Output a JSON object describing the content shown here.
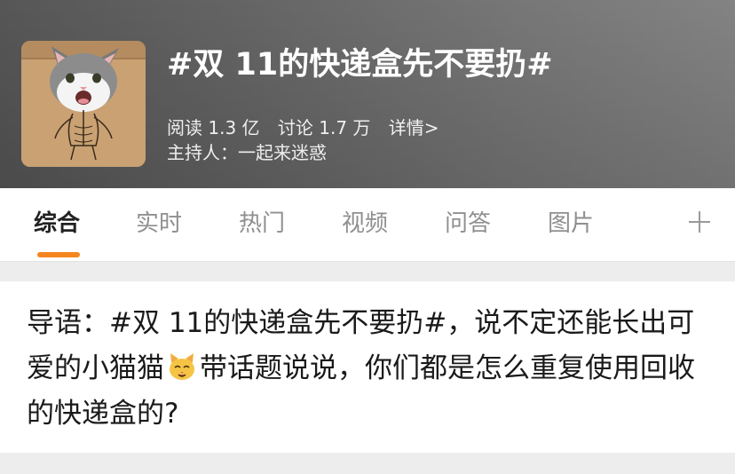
{
  "header": {
    "title": "#双 11的快递盒先不要扔#",
    "stats": {
      "reads": "阅读 1.3 亿",
      "discussions": "讨论 1.7 万",
      "detail_link": "详情>"
    },
    "host": "主持人：一起来迷惑"
  },
  "tabs": [
    {
      "label": "综合",
      "active": true
    },
    {
      "label": "实时",
      "active": false
    },
    {
      "label": "热门",
      "active": false
    },
    {
      "label": "视频",
      "active": false
    },
    {
      "label": "问答",
      "active": false
    },
    {
      "label": "图片",
      "active": false
    }
  ],
  "tab_add_icon": "plus-icon",
  "intro": {
    "part1": "导语：#双 11的快递盒先不要扔#，说不定还能长出可爱的小猫猫",
    "emoji_icon": "cat-face-icon",
    "part2": "带话题说说，你们都是怎么重复使用回收的快递盒的?"
  },
  "colors": {
    "accent": "#f5861f",
    "tab_active": "#222222",
    "tab_inactive": "#8f8f8f",
    "background": "#ededed"
  }
}
